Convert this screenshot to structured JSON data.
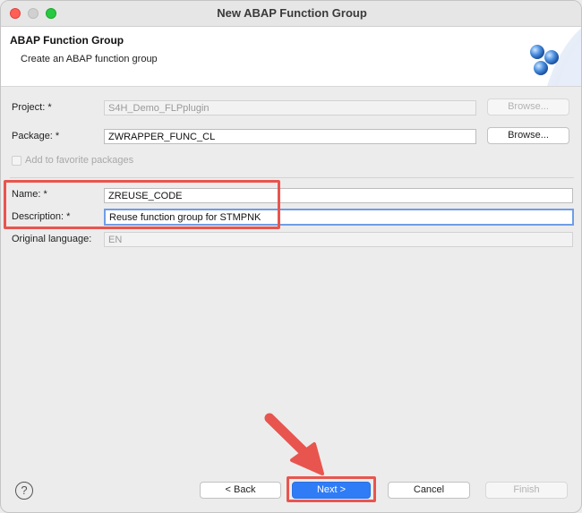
{
  "window": {
    "title": "New ABAP Function Group"
  },
  "header": {
    "title": "ABAP Function Group",
    "subtitle": "Create an ABAP function group"
  },
  "form": {
    "project": {
      "label": "Project: *",
      "value": "S4H_Demo_FLPplugin",
      "browse_label": "Browse..."
    },
    "package": {
      "label": "Package: *",
      "value": "ZWRAPPER_FUNC_CL",
      "browse_label": "Browse..."
    },
    "favorite": {
      "label": "Add to favorite packages",
      "checked": false
    },
    "name": {
      "label": "Name: *",
      "value": "ZREUSE_CODE"
    },
    "description": {
      "label": "Description: *",
      "value": "Reuse function group for STMPNK"
    },
    "language": {
      "label": "Original language:",
      "value": "EN"
    }
  },
  "footer": {
    "help_symbol": "?",
    "back_label": "< Back",
    "next_label": "Next >",
    "cancel_label": "Cancel",
    "finish_label": "Finish"
  },
  "colors": {
    "highlight": "#e8554e",
    "primary": "#2f7cf6",
    "focus": "#6e9ee6"
  },
  "icons": [
    "function-group-spheres-icon",
    "help-icon",
    "annotation-arrow-icon"
  ]
}
